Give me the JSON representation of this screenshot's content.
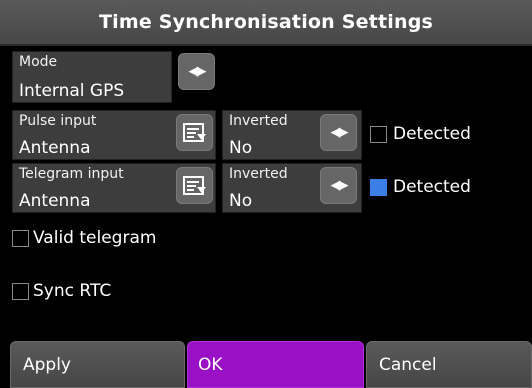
{
  "title": "Time Synchronisation Settings",
  "mode": {
    "label": "Mode",
    "value": "Internal GPS"
  },
  "pulse": {
    "label": "Pulse input",
    "value": "Antenna",
    "inverted_label": "Inverted",
    "inverted_value": "No",
    "detected_label": "Detected",
    "detected": false
  },
  "telegram": {
    "label": "Telegram input",
    "value": "Antenna",
    "inverted_label": "Inverted",
    "inverted_value": "No",
    "detected_label": "Detected",
    "detected": true
  },
  "valid_telegram": {
    "label": "Valid telegram",
    "checked": false
  },
  "sync_rtc": {
    "label": "Sync RTC",
    "checked": false
  },
  "buttons": {
    "apply": "Apply",
    "ok": "OK",
    "cancel": "Cancel"
  },
  "colors": {
    "accent": "#9a10c4",
    "detected_on": "#3a7ee6"
  }
}
